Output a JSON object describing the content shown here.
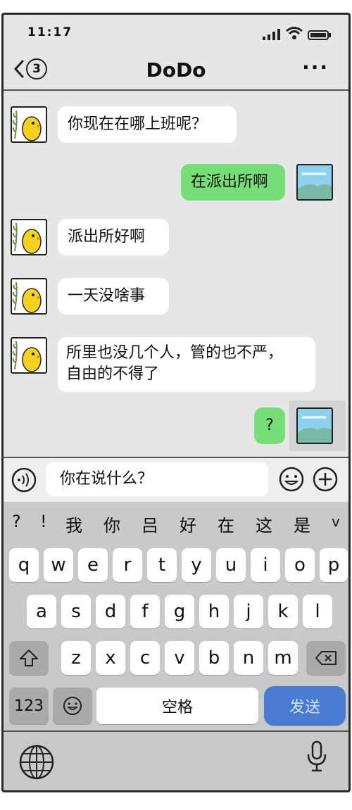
{
  "status": {
    "time": "11:17"
  },
  "nav": {
    "back_badge": "3",
    "title": "DoDo",
    "more": "···"
  },
  "messages": [
    {
      "side": "in",
      "text": "你现在在哪上班呢？"
    },
    {
      "side": "out",
      "text": "在派出所啊"
    },
    {
      "side": "in",
      "text": "派出所好啊"
    },
    {
      "side": "in",
      "text": "一天没啥事"
    },
    {
      "side": "in",
      "text_line1": "所里也没几个人，管的也不严，",
      "text_line2": "自由的不得了"
    },
    {
      "side": "out",
      "text": "?"
    }
  ],
  "input": {
    "value": "你在说什么？"
  },
  "keyboard": {
    "candidates": [
      "?",
      "!",
      "我",
      "你",
      "吕",
      "好",
      "在",
      "这",
      "是",
      "v"
    ],
    "row1": [
      "q",
      "w",
      "e",
      "r",
      "t",
      "y",
      "u",
      "i",
      "o",
      "p"
    ],
    "row2": [
      "a",
      "s",
      "d",
      "f",
      "g",
      "h",
      "j",
      "k",
      "l"
    ],
    "row3": [
      "z",
      "x",
      "c",
      "v",
      "b",
      "n",
      "m"
    ],
    "num_key": "123",
    "space_label": "空格",
    "send_label": "发送"
  },
  "colors": {
    "out_bubble": "#77dd77",
    "send_key": "#4a7bd0"
  }
}
